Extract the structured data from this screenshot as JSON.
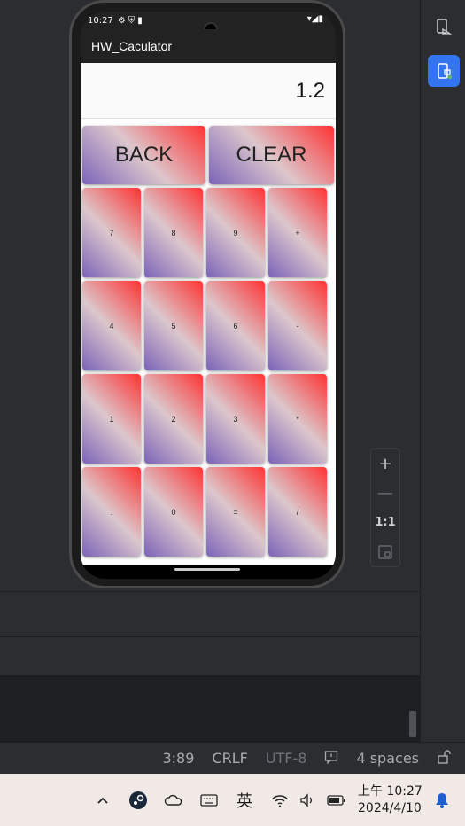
{
  "phone": {
    "status_time": "10:27",
    "app_title": "HW_Caculator",
    "display_value": "1.2",
    "buttons": {
      "back": "BACK",
      "clear": "CLEAR",
      "grid": [
        "7",
        "8",
        "9",
        "+",
        "4",
        "5",
        "6",
        "-",
        "1",
        "2",
        "3",
        "*",
        ".",
        "0",
        "=",
        "/"
      ]
    }
  },
  "zoom_panel": {
    "plus": "+",
    "minus": "—",
    "ratio": "1:1"
  },
  "statusbar": {
    "position": "3:89",
    "line_ending": "CRLF",
    "encoding": "UTF-8",
    "indent": "4 spaces"
  },
  "taskbar": {
    "ime": "英",
    "time": "上午 10:27",
    "date": "2024/4/10"
  },
  "colors": {
    "accent": "#3574f0",
    "button_top": "#f33",
    "button_bottom": "#7b63b8"
  }
}
